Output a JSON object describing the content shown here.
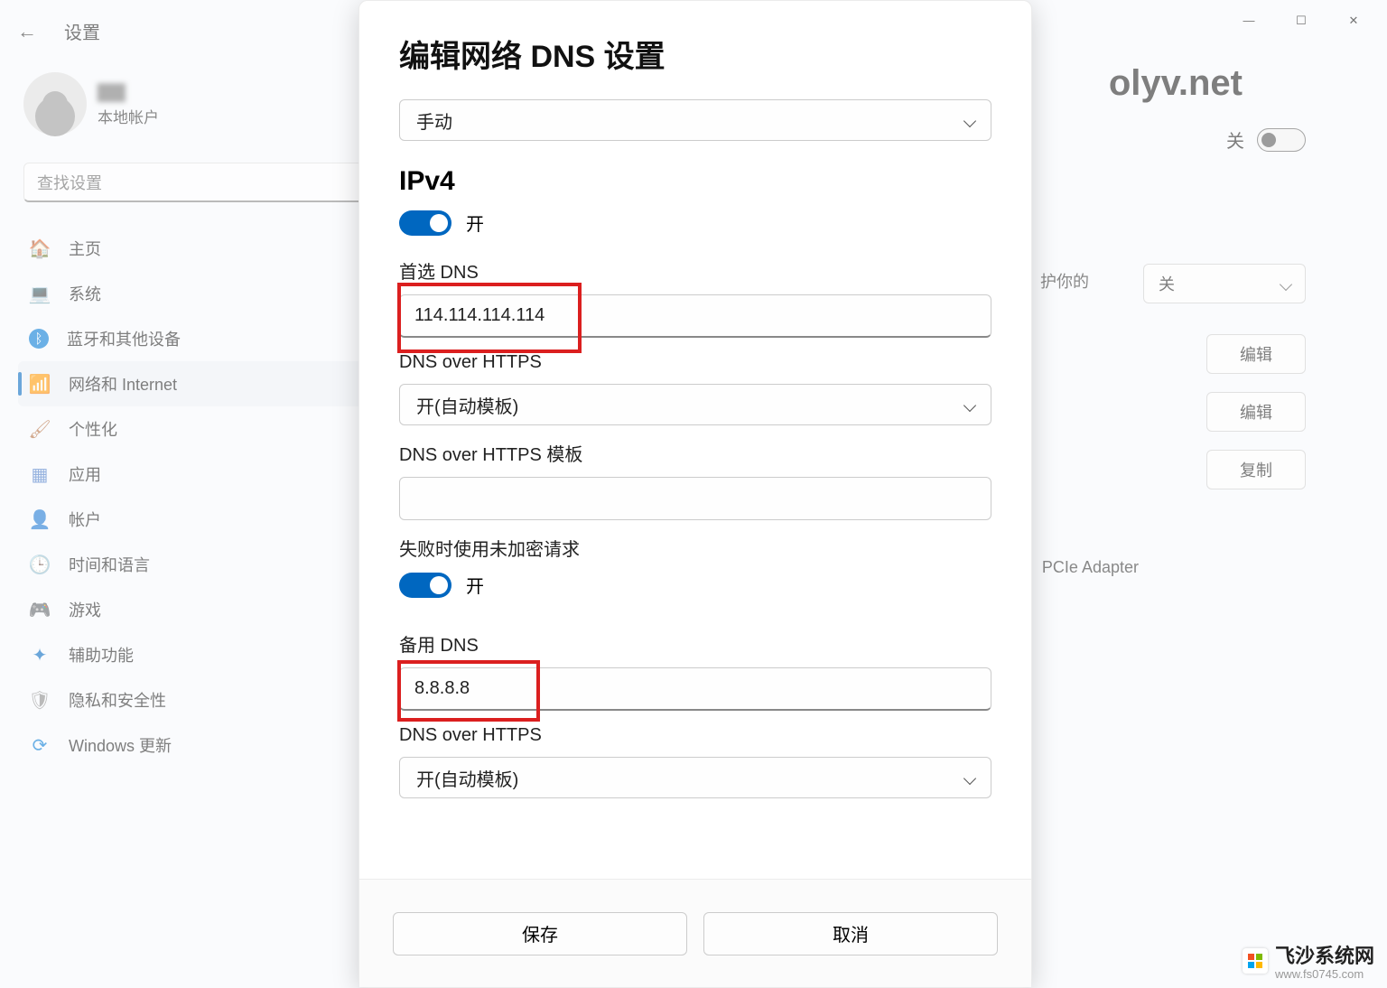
{
  "titlebar": {
    "minimize": "—",
    "maximize": "☐",
    "close": "✕"
  },
  "header": {
    "title": "设置"
  },
  "user": {
    "name": "▇▇",
    "type": "本地帐户"
  },
  "search": {
    "placeholder": "查找设置"
  },
  "sidebar": {
    "items": [
      {
        "label": "主页",
        "icon": "🏠"
      },
      {
        "label": "系统",
        "icon": "💻"
      },
      {
        "label": "蓝牙和其他设备",
        "icon": "ᛒ"
      },
      {
        "label": "网络和 Internet",
        "icon": "📶"
      },
      {
        "label": "个性化",
        "icon": "🖌"
      },
      {
        "label": "应用",
        "icon": "▦"
      },
      {
        "label": "帐户",
        "icon": "👤"
      },
      {
        "label": "时间和语言",
        "icon": "🕒"
      },
      {
        "label": "游戏",
        "icon": "🎮"
      },
      {
        "label": "辅助功能",
        "icon": "✦"
      },
      {
        "label": "隐私和安全性",
        "icon": "🛡"
      },
      {
        "label": "Windows 更新",
        "icon": "⟳"
      }
    ]
  },
  "main": {
    "heading_fragment": "olyv.net",
    "off_label": "关",
    "desc_fragment": "护你的",
    "dd_value": "关",
    "edit": "编辑",
    "copy": "复制",
    "adapter_fragment": "PCIe Adapter"
  },
  "dialog": {
    "title": "编辑网络 DNS 设置",
    "mode": "手动",
    "ipv4_heading": "IPv4",
    "ipv4_toggle": "开",
    "primary_dns_label": "首选 DNS",
    "primary_dns_value": "114.114.114.114",
    "doh1_label": "DNS over HTTPS",
    "doh1_value": "开(自动模板)",
    "doh_template_label": "DNS over HTTPS 模板",
    "doh_template_value": "",
    "fallback_label": "失败时使用未加密请求",
    "fallback_toggle": "开",
    "alt_dns_label": "备用 DNS",
    "alt_dns_value": "8.8.8.8",
    "doh2_label": "DNS over HTTPS",
    "doh2_value": "开(自动模板)",
    "save": "保存",
    "cancel": "取消"
  },
  "watermark": {
    "title": "飞沙系统网",
    "url": "www.fs0745.com"
  },
  "colors": {
    "accent": "#0067c0",
    "highlight": "#db1f1f"
  }
}
